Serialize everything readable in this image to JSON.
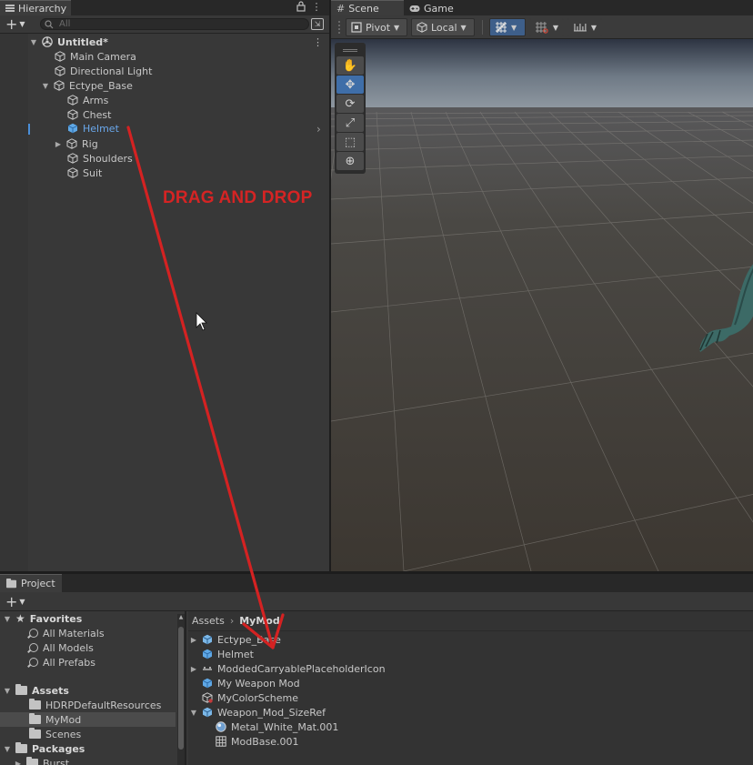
{
  "hierarchy": {
    "tab_label": "Hierarchy",
    "search_placeholder": "All",
    "items": [
      {
        "label": "Untitled*",
        "depth": 0,
        "expanded": true,
        "icon": "unity-scene-icon"
      },
      {
        "label": "Main Camera",
        "depth": 1,
        "icon": "gameobject-icon"
      },
      {
        "label": "Directional Light",
        "depth": 1,
        "icon": "gameobject-icon"
      },
      {
        "label": "Ectype_Base",
        "depth": 1,
        "expanded": true,
        "icon": "gameobject-icon"
      },
      {
        "label": "Arms",
        "depth": 2,
        "icon": "gameobject-icon"
      },
      {
        "label": "Chest",
        "depth": 2,
        "icon": "gameobject-icon"
      },
      {
        "label": "Helmet",
        "depth": 2,
        "selected": true,
        "icon": "prefab-icon"
      },
      {
        "label": "Rig",
        "depth": 2,
        "collapsed": true,
        "icon": "gameobject-icon"
      },
      {
        "label": "Shoulders",
        "depth": 2,
        "icon": "gameobject-icon"
      },
      {
        "label": "Suit",
        "depth": 2,
        "icon": "gameobject-icon"
      }
    ]
  },
  "annotation": {
    "text": "DRAG AND DROP",
    "color": "#d52424"
  },
  "scene": {
    "tabs": [
      {
        "label": "Scene",
        "icon": "grid-icon",
        "active": true
      },
      {
        "label": "Game",
        "icon": "gamepad-icon",
        "active": false
      }
    ],
    "toolbar": {
      "pivot_label": "Pivot",
      "local_label": "Local"
    },
    "tools": [
      "hand-tool",
      "move-tool",
      "rotate-tool",
      "scale-tool",
      "rect-tool",
      "transform-tool"
    ],
    "active_tool": "move-tool"
  },
  "project": {
    "tab_label": "Project",
    "sidebar": {
      "favorites_label": "Favorites",
      "favorites": [
        "All Materials",
        "All Models",
        "All Prefabs"
      ],
      "assets_label": "Assets",
      "asset_folders": [
        "HDRPDefaultResources",
        "MyMod",
        "Scenes"
      ],
      "selected_folder": "MyMod",
      "packages_label": "Packages",
      "package_folders": [
        "Burst"
      ]
    },
    "breadcrumb": {
      "root": "Assets",
      "current": "MyMod"
    },
    "assets": [
      {
        "label": "Ectype_Base",
        "depth": 0,
        "arrow": "collapsed",
        "icon": "prefab-icon"
      },
      {
        "label": "Helmet",
        "depth": 0,
        "arrow": "none",
        "icon": "prefab-icon"
      },
      {
        "label": "ModdedCarryablePlaceholderIcon",
        "depth": 0,
        "arrow": "collapsed",
        "icon": "sprite-icon"
      },
      {
        "label": "My Weapon Mod",
        "depth": 0,
        "arrow": "none",
        "icon": "prefab-icon"
      },
      {
        "label": "MyColorScheme",
        "depth": 0,
        "arrow": "none",
        "icon": "scriptable-object-icon"
      },
      {
        "label": "Weapon_Mod_SizeRef",
        "depth": 0,
        "arrow": "expanded",
        "icon": "model-prefab-icon"
      },
      {
        "label": "Metal_White_Mat.001",
        "depth": 1,
        "arrow": "none",
        "icon": "material-icon"
      },
      {
        "label": "ModBase.001",
        "depth": 1,
        "arrow": "none",
        "icon": "mesh-icon"
      }
    ]
  }
}
